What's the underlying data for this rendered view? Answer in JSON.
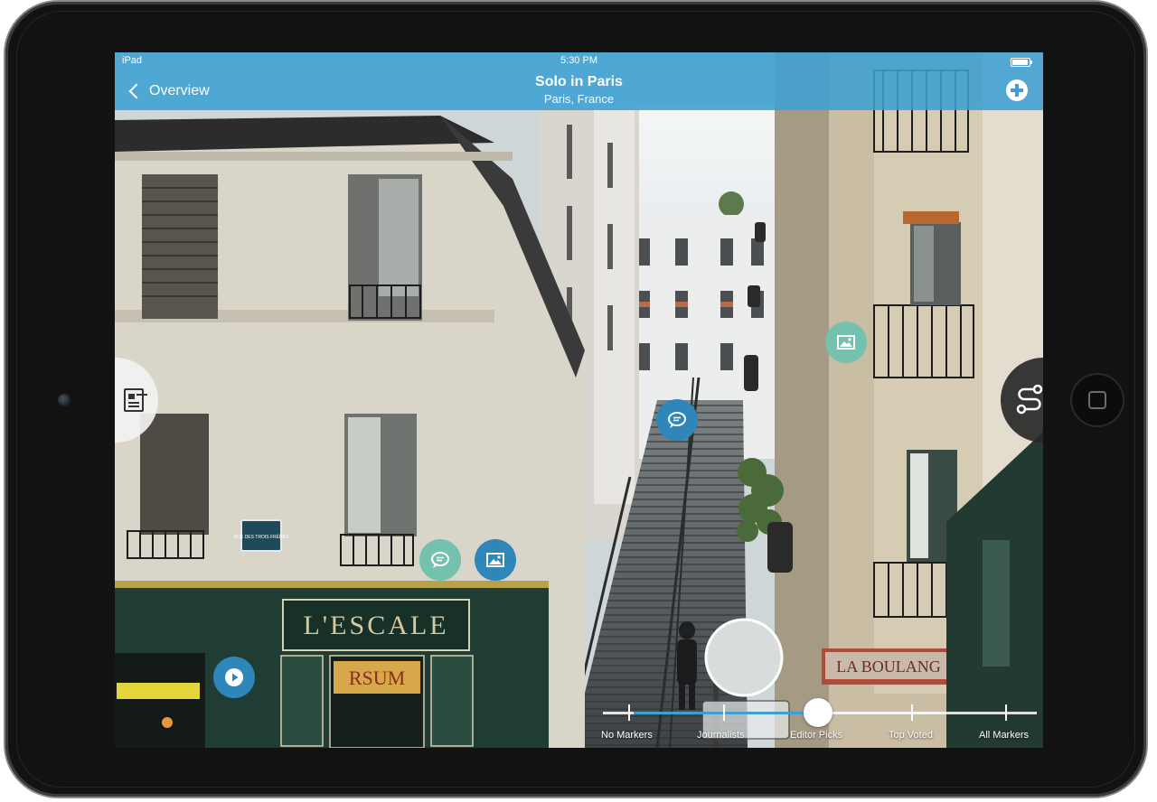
{
  "status_bar": {
    "device": "iPad",
    "time": "5:30 PM"
  },
  "nav": {
    "back_label": "Overview",
    "title": "Solo in Paris",
    "subtitle": "Paris, France"
  },
  "markers": [
    {
      "type": "comment",
      "icon": "speech-bubble-icon",
      "color": "#2f86b8"
    },
    {
      "type": "photo",
      "icon": "image-icon",
      "color": "#74c1ae"
    },
    {
      "type": "comment",
      "icon": "speech-bubble-icon",
      "color": "#74c1ae"
    },
    {
      "type": "photo",
      "icon": "image-icon",
      "color": "#2f86b8"
    },
    {
      "type": "video",
      "icon": "play-icon",
      "color": "#2f86b8"
    }
  ],
  "filter_slider": {
    "stops": [
      "No Markers",
      "Journalists",
      "Editor Picks",
      "Top Voted",
      "All Markers"
    ],
    "selected": "Editor Picks",
    "selected_index": 2
  },
  "sign_texts": {
    "street_sign": "RUE DES TROIS FRÈRES",
    "shop_name": "L'ESCALE",
    "bar_sign": "RSUM",
    "bakery": "LA BOULANG"
  },
  "colors": {
    "nav_bar": "#3ea0d2",
    "accent": "#3ea0d2",
    "marker_dark": "#2f86b8",
    "marker_light": "#74c1ae"
  }
}
